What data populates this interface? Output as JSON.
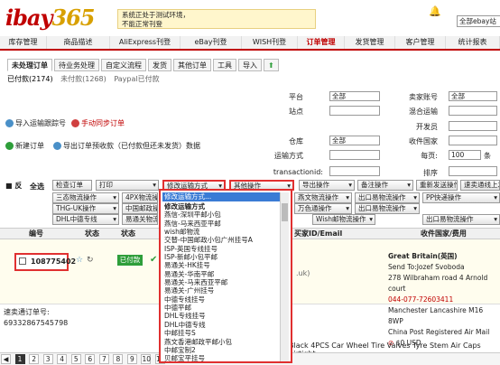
{
  "header": {
    "logo_main": "ibay",
    "logo_num": "365",
    "notice_line1": "系统正处于测试环境，",
    "notice_line2": "不能正常刊登",
    "site_select": "全部ebay站"
  },
  "nav": [
    "库存管理",
    "商品描述",
    "AliExpress刊登",
    "eBay刊登",
    "WISH刊登",
    "订单管理",
    "发货管理",
    "客户管理",
    "统计报表"
  ],
  "nav_active_index": 5,
  "subtabs": [
    "未处理订单",
    "待业务处理",
    "自定义流程",
    "发货",
    "其他订单",
    "工具",
    "导入"
  ],
  "status": {
    "paid": "已付款(2174)",
    "unpaid": "未付款(1268)",
    "paypal": "Paypal已付款"
  },
  "left_actions": {
    "import_tracking": "导入运输跟踪号",
    "manual_sync": "手动同步订单",
    "new_order": "新建订单",
    "export_forecast": "导出订单预收款（已付款但还未发货）数据"
  },
  "filters": {
    "platform": {
      "label": "平台",
      "value": "全部"
    },
    "site": {
      "label": "站点"
    },
    "warehouse": {
      "label": "仓库",
      "value": "全部"
    },
    "shipping": {
      "label": "运输方式",
      "value": ""
    },
    "transaction_id": {
      "label": "transactionid:"
    },
    "seller": {
      "label": "卖家账号",
      "value": "全部"
    },
    "mixed_carrier": {
      "label": "混合运输"
    },
    "developer": {
      "label": "开发员"
    },
    "buyer_country": {
      "label": "收件国家"
    },
    "page_size": {
      "label": "每页:",
      "value": "100",
      "unit": "条"
    },
    "sort": {
      "label": "排序"
    }
  },
  "toolbar": {
    "select_all": "全选",
    "reverse": "反",
    "check_order": "检查订单",
    "print": "打印",
    "modify_shipping": "修改运输方式",
    "other_ops": "其他操作",
    "export_ops": "导出操作",
    "remark_ops": "备注操作",
    "resend": "重新发送操作",
    "ebay_ops": "速卖通线上发货",
    "row2": [
      "三态物流操作",
      "4PX物流操作",
      "燕文物流操作",
      "出口易物流操作",
      "PP快递操作"
    ],
    "row3": [
      "THG-UK操作",
      "中国邮政操作",
      "万色通操作",
      "出口易物流操作"
    ],
    "row4": [
      "DHL中德专线",
      "易通关物流操作",
      "Wish邮物流操作",
      "出口易物流操作"
    ]
  },
  "dropdown": {
    "search": "修改运输方式...",
    "items": [
      {
        "text": "修改运输方式",
        "group": true
      },
      {
        "text": "燕信-深圳平邮小包"
      },
      {
        "text": "燕信-马来西亚平邮"
      },
      {
        "text": "wish邮物流"
      },
      {
        "text": "交替-中国邮政小包广州挂号A"
      },
      {
        "text": "ISP-英国专线挂号"
      },
      {
        "text": "ISP-新邮小包平邮"
      },
      {
        "text": "易通关-HK挂号"
      },
      {
        "text": "易通关-华南平邮"
      },
      {
        "text": "易通关-马来西亚平邮"
      },
      {
        "text": "易通关-广州挂号"
      },
      {
        "text": "中德专线挂号"
      },
      {
        "text": "中德平邮"
      },
      {
        "text": "DHL专线挂号"
      },
      {
        "text": "DHL中德专线"
      },
      {
        "text": "中邮挂号S"
      },
      {
        "text": "燕文香港邮政平邮小包"
      },
      {
        "text": "中邮宝制2"
      },
      {
        "text": "贝邮宝平挂号"
      }
    ]
  },
  "table": {
    "headers": {
      "no": "编号",
      "status": "状态",
      "state": "状态",
      "buyer": "买家ID/Email",
      "country": "收件国家/费用"
    },
    "row": {
      "order_no": "108775402",
      "paid_badge": "已付款",
      "buyer_hint": ".uk)",
      "country": "Great Britain(英国)",
      "send_to": "Send To:Jozef Svoboda",
      "addr1": "278 Wilbraham road 4 Arnold court",
      "phone": "044-077-72603411",
      "addr2": "Manchester Lancashire M16 8WP",
      "post": "China Post Registered Air Mail",
      "fee": "$0 USD"
    }
  },
  "tracking": {
    "label": "速卖通订单号:",
    "number": "69332867545798"
  },
  "product": "Black 4PCS Car Wheel Tire Valves Tyre Stem Air Caps Airtight",
  "pager": [
    "1",
    "2",
    "3",
    "4",
    "5",
    "6",
    "7",
    "8",
    "9",
    "10",
    "11"
  ]
}
